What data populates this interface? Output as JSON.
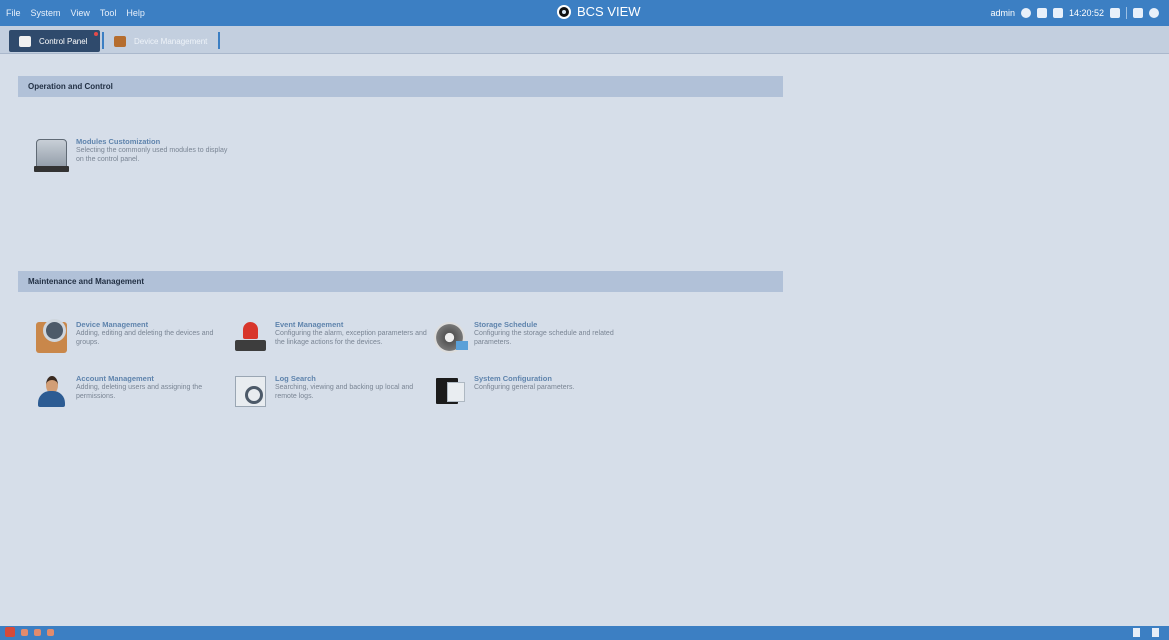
{
  "menubar": {
    "menus": [
      "File",
      "System",
      "View",
      "Tool",
      "Help"
    ],
    "app_title": "BCS VIEW",
    "user": "admin",
    "clock": "14:20:52",
    "bar_color": "#3c7fc3"
  },
  "tabs": [
    {
      "label": "Control Panel",
      "icon": "home-icon",
      "active": true
    },
    {
      "label": "Device Management",
      "icon": "device-icon",
      "active": false
    }
  ],
  "sections": {
    "operation": {
      "title": "Operation and Control",
      "modules": [
        {
          "title": "Modules Customization",
          "desc": "Selecting the commonly used modules to display on the control panel.",
          "icon": "modules-icon"
        }
      ]
    },
    "maintenance": {
      "title": "Maintenance and Management",
      "modules": [
        {
          "title": "Device Management",
          "desc": "Adding, editing and deleting the devices and groups.",
          "icon": "device-management-icon"
        },
        {
          "title": "Event Management",
          "desc": "Configuring the alarm, exception parameters and the linkage actions for the devices.",
          "icon": "event-alarm-icon"
        },
        {
          "title": "Storage Schedule",
          "desc": "Configuring the storage schedule and related parameters.",
          "icon": "storage-reel-icon"
        },
        {
          "title": "Account Management",
          "desc": "Adding, deleting users and assigning the permissions.",
          "icon": "user-account-icon"
        },
        {
          "title": "Log Search",
          "desc": "Searching, viewing and backing up local and remote logs.",
          "icon": "log-search-icon"
        },
        {
          "title": "System Configuration",
          "desc": "Configuring general parameters.",
          "icon": "system-config-icon"
        }
      ]
    }
  }
}
